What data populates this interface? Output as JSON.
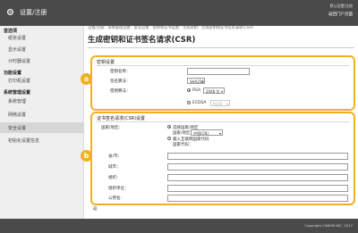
{
  "app": {
    "title": "设置/注册",
    "top_right_label": "默认设置/注册",
    "top_right_link": "返回门户页面"
  },
  "sidebar": {
    "groups": [
      {
        "label": "首选项",
        "items": [
          "纸张设置",
          "显示设置",
          "计时器设置"
        ]
      },
      {
        "label": "功能设置",
        "items": [
          "打印机设置"
        ]
      },
      {
        "label": "系统管理设置",
        "items": [
          "系统管理",
          "网络设置",
          "安全设置",
          "初始化设置信息"
        ]
      }
    ],
    "active": "安全设置"
  },
  "breadcrumb": "设置/注册：系统管理设置：安全设置：密钥和证书设置：生成密钥：生成密钥和证书签名请求(CSR)",
  "page_title": "生成密钥和证书签名请求(CSR)",
  "key_section": {
    "title": "密钥设置",
    "key_name_label": "密钥名称：",
    "signature_algorithm_label": "签名算法：",
    "signature_algorithm_value": "SHA256",
    "key_algorithm_label": "密钥算法：",
    "rsa_label": "RSA",
    "rsa_bits": "2048 位",
    "ecdsa_label": "ECDSA",
    "ecdsa_curve": "P256"
  },
  "csr_section": {
    "title": "证书签名请求(CSR)设置",
    "country_label": "国家/地区：",
    "select_country_option": "选择国家/地区",
    "country_select_value": "中国(CN)",
    "enter_code_option": "输入互联网国家代码",
    "country_code_label": "国家代码：",
    "fields": [
      "省/市：",
      "城市：",
      "组织：",
      "组织单位：",
      "公用名："
    ]
  },
  "note": "返",
  "footer": {
    "copyright": "Copyright CANON INC. 2017"
  },
  "callouts": [
    "a",
    "b"
  ],
  "accent_color": "#f2b01e"
}
